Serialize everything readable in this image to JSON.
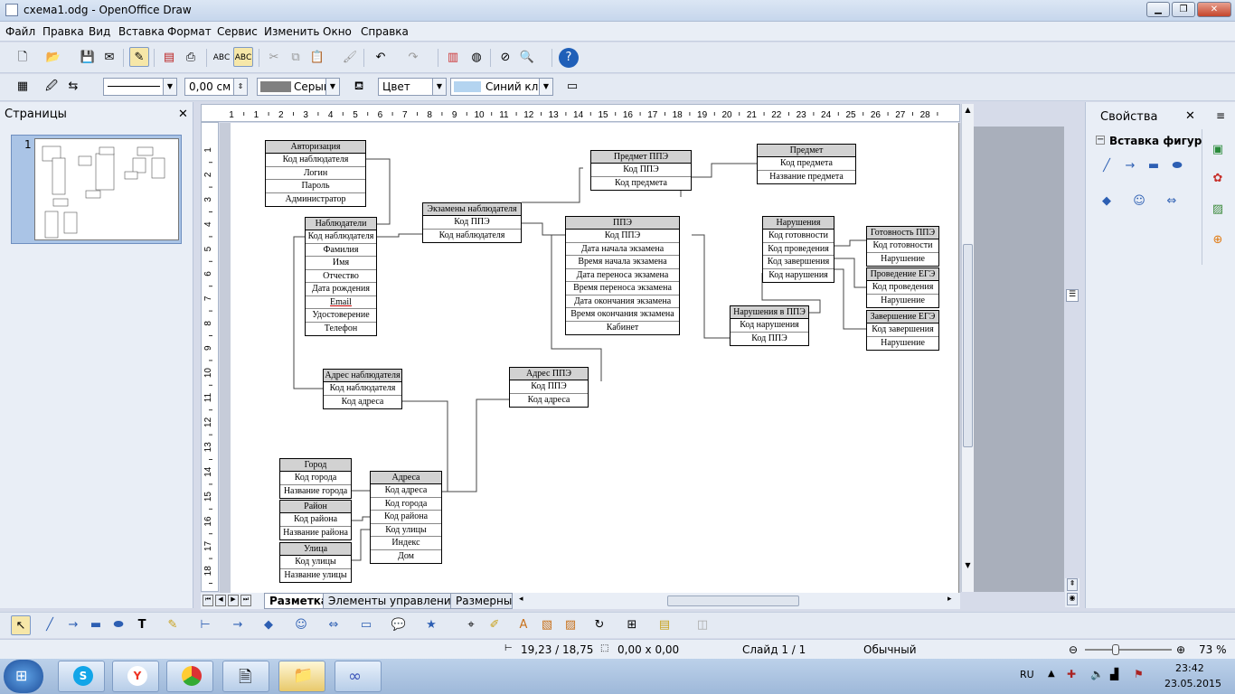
{
  "window": {
    "title": "схема1.odg - OpenOffice Draw"
  },
  "menu": [
    "Файл",
    "Правка",
    "Вид",
    "Вставка",
    "Формат",
    "Сервис",
    "Изменить",
    "Окно",
    "Справка"
  ],
  "line_toolbar": {
    "width_value": "0,00 см",
    "line_color": "Серый",
    "area_style": "Цвет",
    "area_color": "Синий кла"
  },
  "pages_panel": {
    "title": "Страницы",
    "page_number": "1"
  },
  "ruler": {
    "h_labels": [
      "1",
      "1",
      "2",
      "3",
      "4",
      "5",
      "6",
      "7",
      "8",
      "9",
      "10",
      "11",
      "12",
      "13",
      "14",
      "15",
      "16",
      "17",
      "18",
      "19",
      "20",
      "21",
      "22",
      "23",
      "24",
      "25",
      "26",
      "27",
      "28"
    ],
    "v_labels": [
      "1",
      "2",
      "3",
      "4",
      "5",
      "6",
      "7",
      "8",
      "9",
      "10",
      "11",
      "12",
      "13",
      "14",
      "15",
      "16",
      "17",
      "18"
    ]
  },
  "tables": [
    {
      "title": "Авторизация",
      "rows": [
        "Код наблюдателя",
        "Логин",
        "Пароль",
        "Администратор"
      ]
    },
    {
      "title": "Наблюдатели",
      "rows": [
        "Код наблюдателя",
        "Фамилия",
        "Имя",
        "Отчество",
        "Дата рождения",
        "Email",
        "Удостоверение",
        "Телефон"
      ]
    },
    {
      "title": "Экзамены наблюдателя",
      "rows": [
        "Код ППЭ",
        "Код наблюдателя"
      ]
    },
    {
      "title": "Предмет ППЭ",
      "rows": [
        "Код ППЭ",
        "Код предмета"
      ]
    },
    {
      "title": "Предмет",
      "rows": [
        "Код предмета",
        "Название предмета"
      ]
    },
    {
      "title": "ППЭ",
      "rows": [
        "Код ППЭ",
        "Дата начала экзамена",
        "Время начала экзамена",
        "Дата переноса экзамена",
        "Время переноса экзамена",
        "Дата окончания экзамена",
        "Время окончания экзамена",
        "Кабинет"
      ]
    },
    {
      "title": "Нарушения",
      "rows": [
        "Код готовности",
        "Код проведения",
        "Код завершения",
        "Код нарушения"
      ]
    },
    {
      "title": "Готовность ППЭ",
      "rows": [
        "Код готовности",
        "Нарушение"
      ]
    },
    {
      "title": "Проведение ЕГЭ",
      "rows": [
        "Код проведения",
        "Нарушение"
      ]
    },
    {
      "title": "Завершение ЕГЭ",
      "rows": [
        "Код завершения",
        "Нарушение"
      ]
    },
    {
      "title": "Нарушения в ППЭ",
      "rows": [
        "Код нарушения",
        "Код ППЭ"
      ]
    },
    {
      "title": "Адрес наблюдателя",
      "rows": [
        "Код наблюдателя",
        "Код адреса"
      ]
    },
    {
      "title": "Адрес ППЭ",
      "rows": [
        "Код ППЭ",
        "Код адреса"
      ]
    },
    {
      "title": "Город",
      "rows": [
        "Код города",
        "Название города"
      ]
    },
    {
      "title": "Район",
      "rows": [
        "Код района",
        "Название района"
      ]
    },
    {
      "title": "Улица",
      "rows": [
        "Код улицы",
        "Название улицы"
      ]
    },
    {
      "title": "Адреса",
      "rows": [
        "Код адреса",
        "Код города",
        "Код района",
        "Код улицы",
        "Индекс",
        "Дом"
      ]
    }
  ],
  "sheet_tabs": [
    "Разметка",
    "Элементы управления",
    "Размерные"
  ],
  "properties_panel": {
    "title": "Свойства",
    "section": "Вставка фигур"
  },
  "status": {
    "position": "19,23 / 18,75",
    "size": "0,00 x 0,00",
    "slide": "Слайд 1 / 1",
    "style": "Обычный",
    "zoom": "73 %"
  },
  "taskbar": {
    "lang": "RU",
    "time": "23:42",
    "date": "23.05.2015"
  },
  "colors": {
    "table_header": "#d2d2d2",
    "page": "#ffffff",
    "workspace": "#c6ccd9"
  }
}
